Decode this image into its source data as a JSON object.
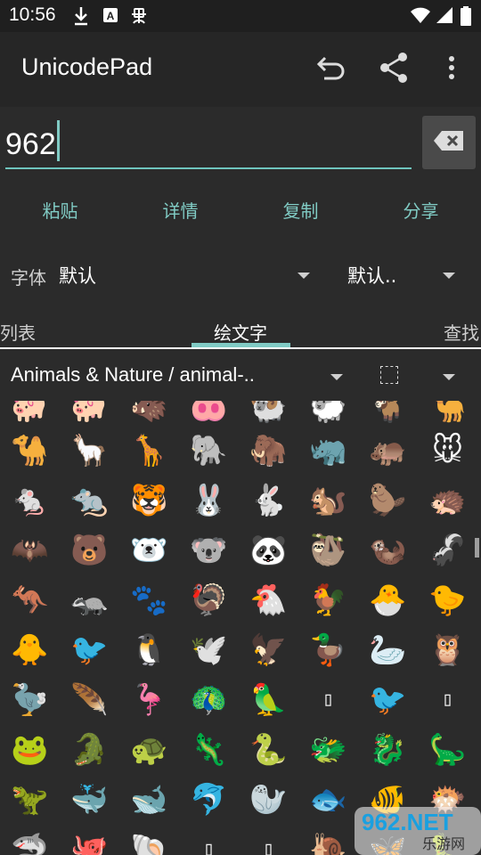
{
  "status": {
    "time": "10:56"
  },
  "appbar": {
    "title": "UnicodePad"
  },
  "input": {
    "value": "962"
  },
  "actions": [
    "粘贴",
    "详情",
    "复制",
    "分享"
  ],
  "font": {
    "label": "字体",
    "value": "默认",
    "value2": "默认.."
  },
  "tabs": {
    "left": "列表",
    "center": "绘文字",
    "right": "查找"
  },
  "category": {
    "label": "Animals & Nature / animal-.."
  },
  "emoji_rows": [
    [
      "🐖",
      "🐖",
      "🐗",
      "🐽",
      "🐏",
      "🐑",
      "🐐",
      "🐪"
    ],
    [
      "🐪",
      "🦙",
      "🦒",
      "🐘",
      "🦣",
      "🦏",
      "🦛",
      "🐭"
    ],
    [
      "🐁",
      "🐀",
      "🐯",
      "🐰",
      "🐇",
      "🐿️",
      "🦫",
      "🦔"
    ],
    [
      "🦇",
      "🐻",
      "🐻‍❄️",
      "🐨",
      "🐼",
      "🦥",
      "🦦",
      "🦨"
    ],
    [
      "🦘",
      "🦡",
      "🐾",
      "🦃",
      "🐔",
      "🐓",
      "🐣",
      "🐤"
    ],
    [
      "🐥",
      "🐦",
      "🐧",
      "🕊️",
      "🦅",
      "🦆",
      "🦢",
      "🦉"
    ],
    [
      "🦤",
      "🪶",
      "🦩",
      "🦚",
      "🦜",
      "▯",
      "🐦",
      "▯"
    ],
    [
      "🐸",
      "🐊",
      "🐢",
      "🦎",
      "🐍",
      "🐲",
      "🐉",
      "🦕"
    ],
    [
      "🦖",
      "🐳",
      "🐋",
      "🐬",
      "🦭",
      "🐟",
      "🐠",
      "🐡"
    ],
    [
      "🦈",
      "🐙",
      "🐚",
      "▯",
      "▯",
      "🐌",
      "🦋",
      "🐛"
    ]
  ],
  "watermark": {
    "line1": "962.NET",
    "line2": "乐游网"
  }
}
